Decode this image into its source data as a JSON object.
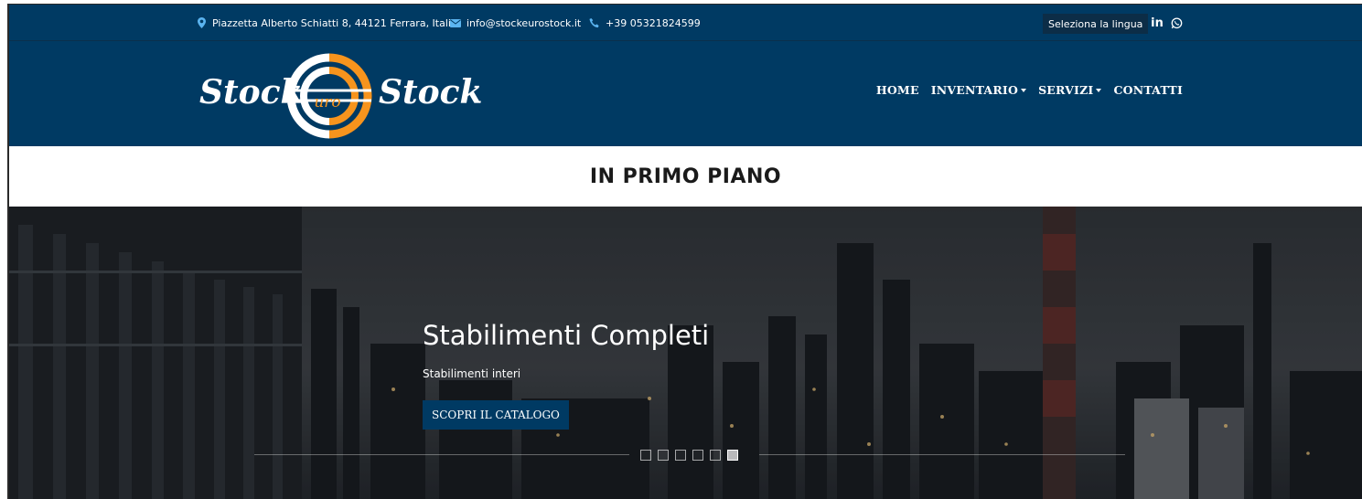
{
  "topbar": {
    "address": "Piazzetta Alberto Schiatti 8, 44121 Ferrara, Italia",
    "email": "info@stockeurostock.it",
    "phone": "+39 05321824599",
    "language_label": "Seleziona la lingua",
    "social": [
      "linkedin-icon",
      "whatsapp-icon"
    ]
  },
  "brand": {
    "name": "StockEuroStock",
    "colors": {
      "primary": "#003a63",
      "accent": "#f7941d"
    }
  },
  "nav": {
    "items": [
      {
        "label": "HOME",
        "dropdown": false
      },
      {
        "label": "INVENTARIO",
        "dropdown": true
      },
      {
        "label": "SERVIZI",
        "dropdown": true
      },
      {
        "label": "CONTATTI",
        "dropdown": false
      }
    ]
  },
  "section": {
    "title": "IN PRIMO PIANO"
  },
  "hero": {
    "title": "Stabilimenti Completi",
    "subtitle": "Stabilimenti interi",
    "button_label": "SCOPRI IL CATALOGO",
    "slides_count": 6,
    "active_slide": 6
  }
}
